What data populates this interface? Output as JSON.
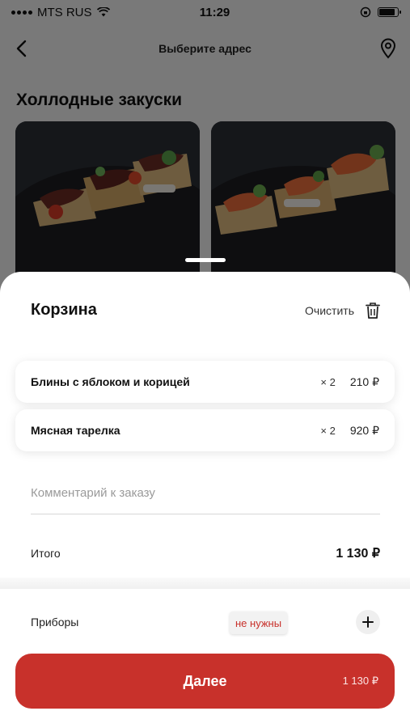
{
  "status_bar": {
    "carrier": "MTS RUS",
    "time": "11:29",
    "battery_level": 0.85
  },
  "nav": {
    "title": "Выберите адрес",
    "back_icon": "chevron-left-icon",
    "location_icon": "location-pin-icon"
  },
  "menu": {
    "section_title": "Холлодные закуски",
    "cards": [
      {
        "name": "bruschetta-beef"
      },
      {
        "name": "bruschetta-salmon"
      }
    ]
  },
  "cart": {
    "title": "Корзина",
    "clear_label": "Очистить",
    "clear_icon": "trash-icon",
    "items": [
      {
        "name": "Блины с яблоком и корицей",
        "qty": "× 2",
        "price": "210 ₽"
      },
      {
        "name": "Мясная тарелка",
        "qty": "× 2",
        "price": "920 ₽"
      }
    ],
    "comment_placeholder": "Комментарий к заказу",
    "total_label": "Итого",
    "total_value": "1 130 ₽",
    "cutlery_label": "Приборы",
    "cutlery_value": "не нужны",
    "next_label": "Далее",
    "next_price": "1 130 ₽"
  },
  "colors": {
    "accent": "#c8312b",
    "overlay": "rgba(0,0,0,0.5)"
  }
}
